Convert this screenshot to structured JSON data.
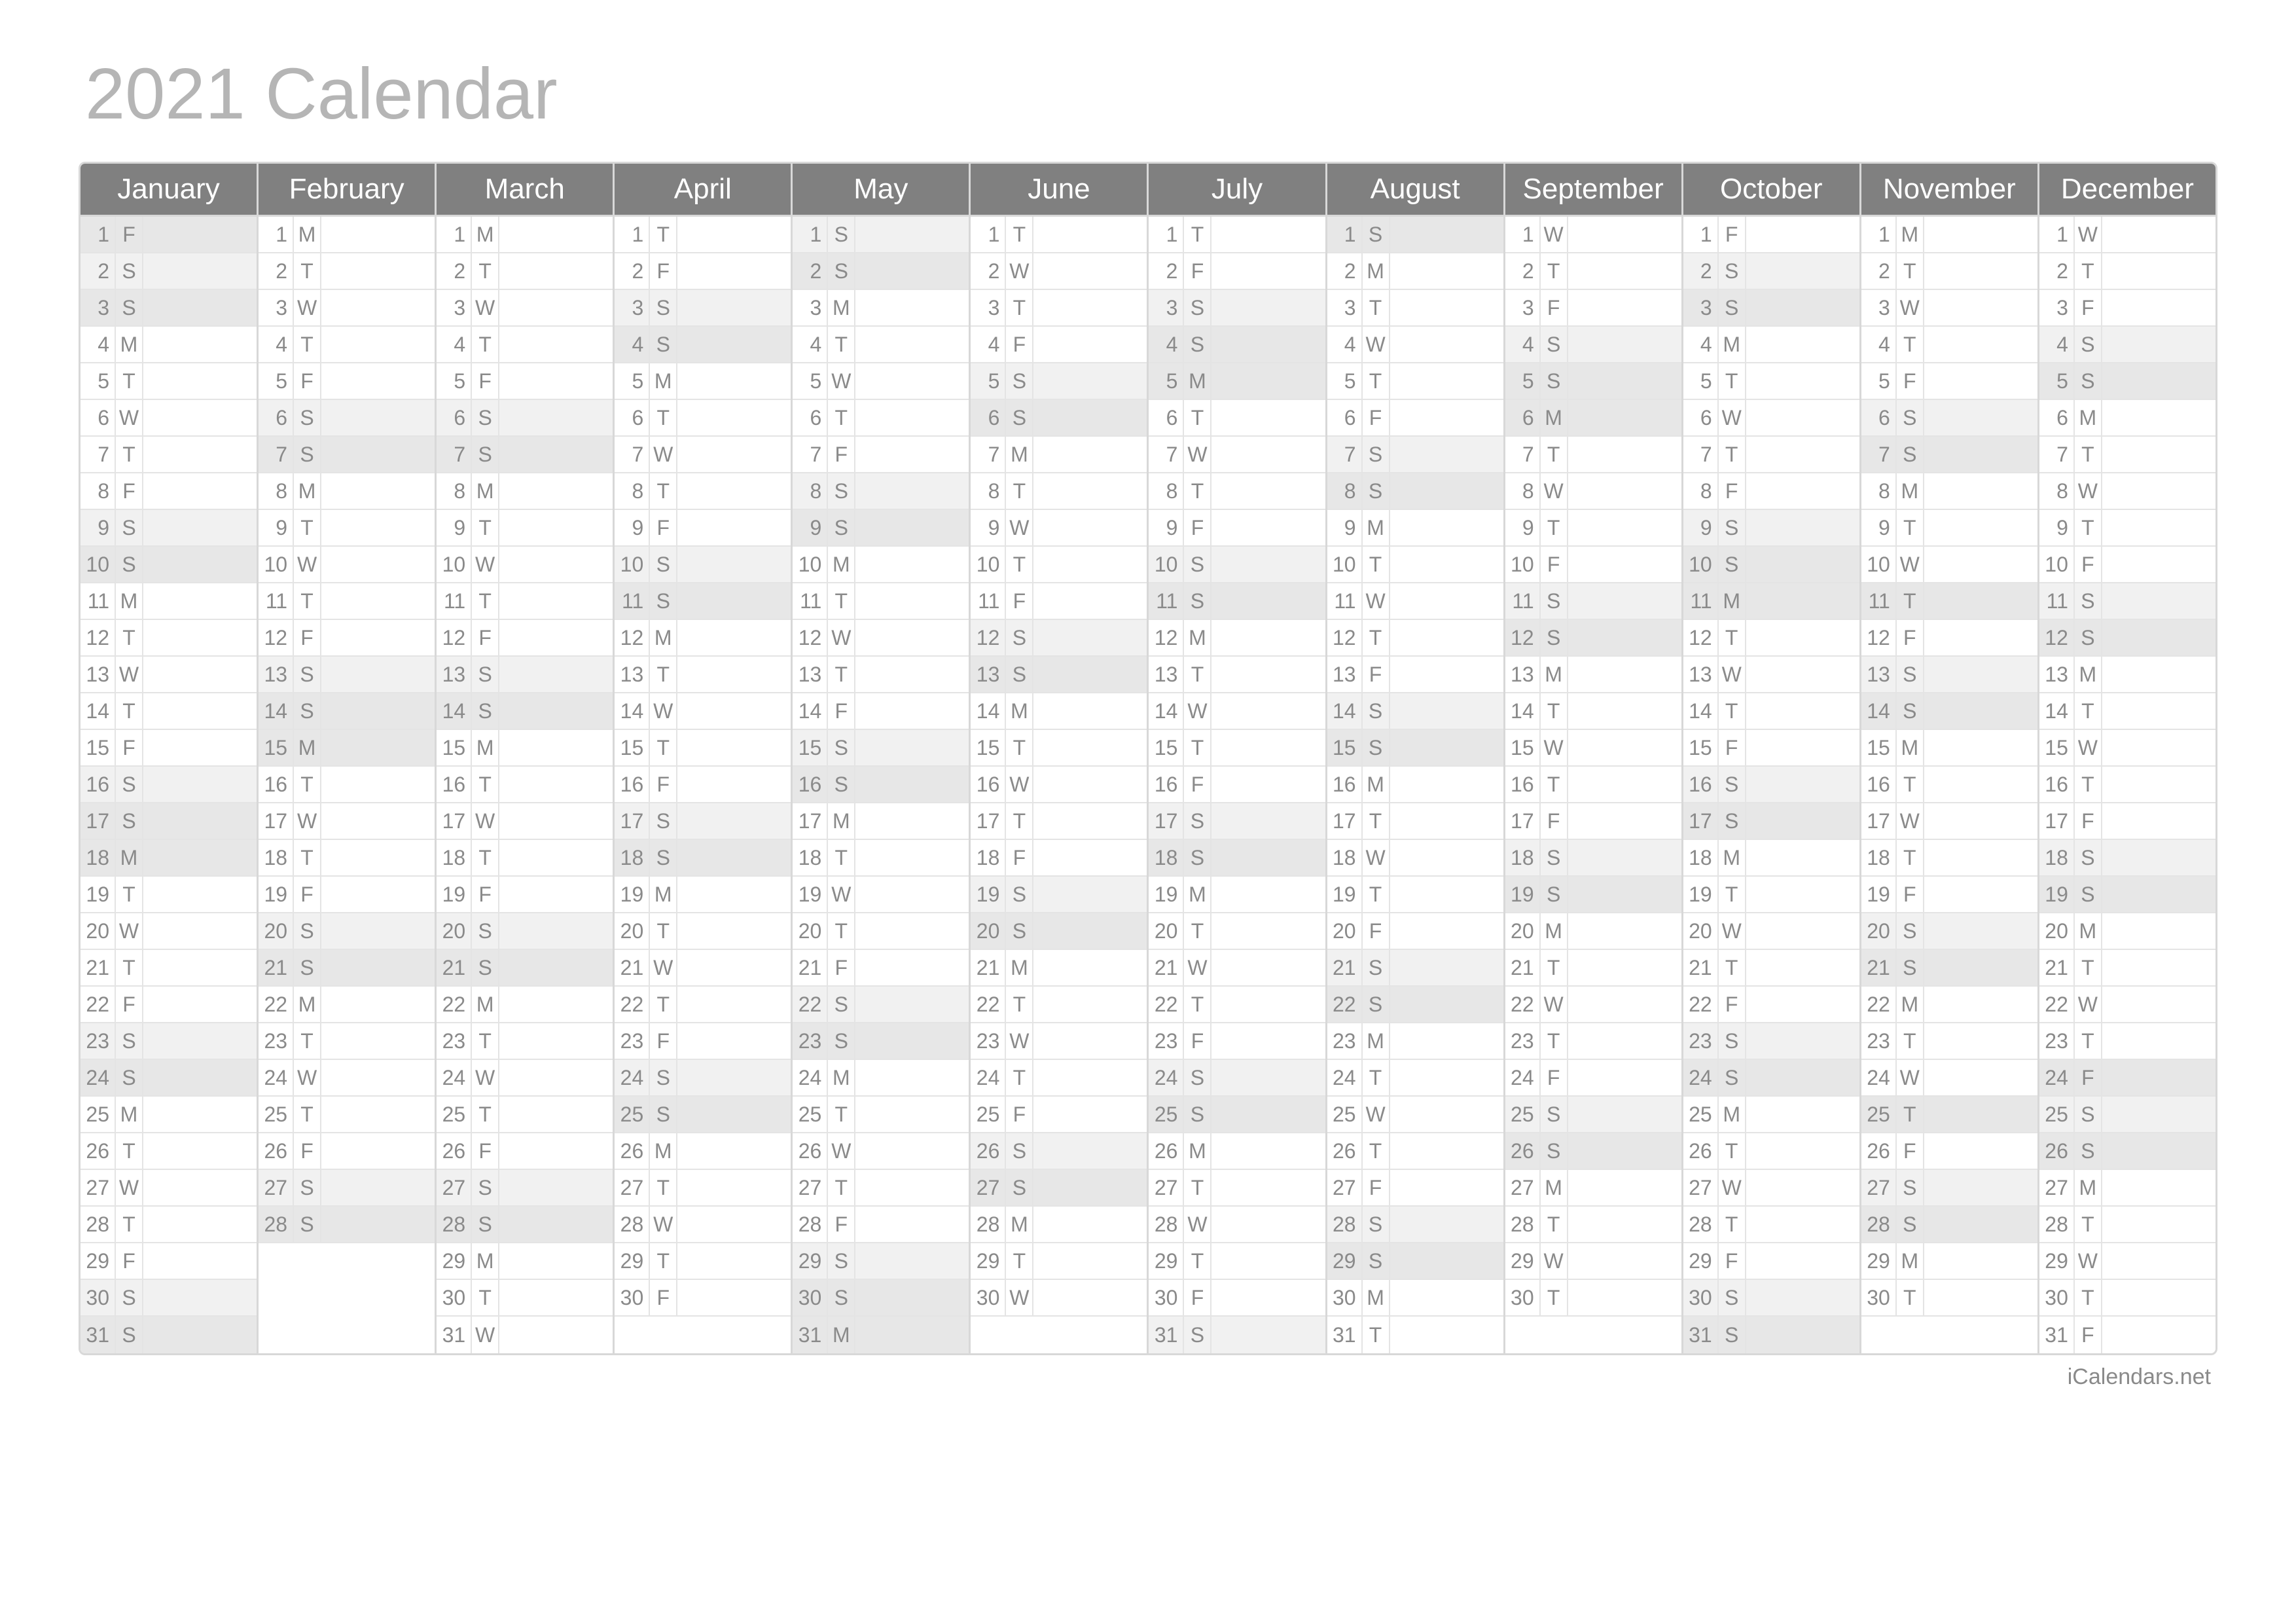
{
  "title": "2021 Calendar",
  "attribution": "iCalendars.net",
  "weekdays": [
    "S",
    "M",
    "T",
    "W",
    "T",
    "F",
    "S"
  ],
  "months": [
    {
      "name": "January",
      "days": 31,
      "startWeekday": 5
    },
    {
      "name": "February",
      "days": 28,
      "startWeekday": 1
    },
    {
      "name": "March",
      "days": 31,
      "startWeekday": 1
    },
    {
      "name": "April",
      "days": 30,
      "startWeekday": 4
    },
    {
      "name": "May",
      "days": 31,
      "startWeekday": 6
    },
    {
      "name": "June",
      "days": 30,
      "startWeekday": 2
    },
    {
      "name": "July",
      "days": 31,
      "startWeekday": 4
    },
    {
      "name": "August",
      "days": 31,
      "startWeekday": 0
    },
    {
      "name": "September",
      "days": 30,
      "startWeekday": 3
    },
    {
      "name": "October",
      "days": 31,
      "startWeekday": 5
    },
    {
      "name": "November",
      "days": 30,
      "startWeekday": 1
    },
    {
      "name": "December",
      "days": 31,
      "startWeekday": 3
    }
  ],
  "shading": {
    "saturday": "gray1",
    "sunday": "gray2"
  },
  "specialShading": {
    "January": {
      "1": "gray2",
      "18": "gray2"
    },
    "February": {
      "15": "gray2"
    },
    "May": {
      "31": "gray2"
    },
    "July": {
      "4": "gray2",
      "5": "gray2"
    },
    "September": {
      "6": "gray2"
    },
    "October": {
      "11": "gray2"
    },
    "November": {
      "11": "gray2",
      "25": "gray2"
    },
    "December": {
      "24": "gray2"
    }
  },
  "maxRows": 31
}
